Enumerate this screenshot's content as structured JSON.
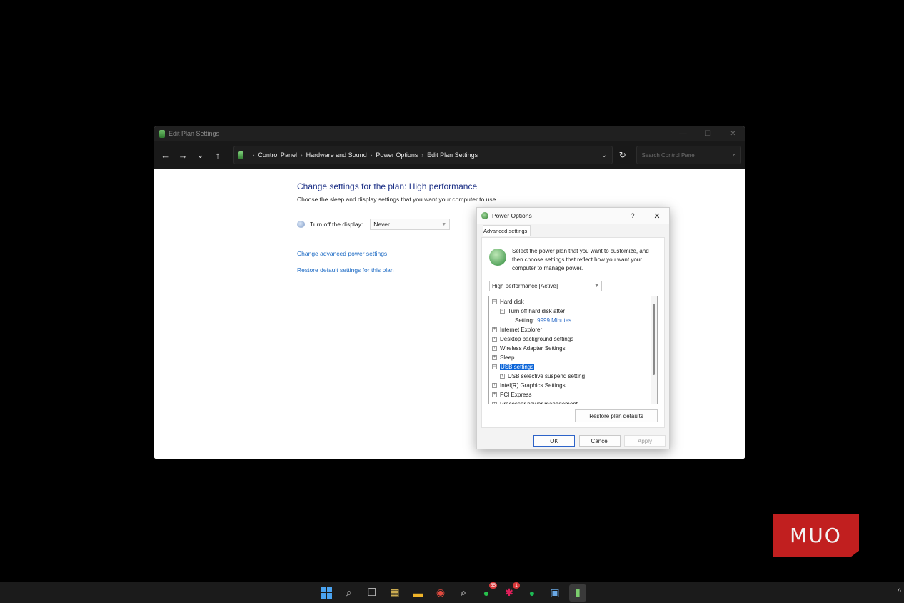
{
  "window": {
    "title": "Edit Plan Settings",
    "controls": {
      "minimize": "—",
      "maximize": "☐",
      "close": "✕"
    }
  },
  "nav": {
    "back": "←",
    "forward": "→",
    "recent": "⌄",
    "up": "↑",
    "breadcrumbs": [
      "Control Panel",
      "Hardware and Sound",
      "Power Options",
      "Edit Plan Settings"
    ],
    "separator": "›",
    "dropdown": "⌄",
    "refresh": "↻",
    "search_placeholder": "Search Control Panel",
    "search_icon": "⌕"
  },
  "main": {
    "heading": "Change settings for the plan: High performance",
    "subheading": "Choose the sleep and display settings that you want your computer to use.",
    "display_label": "Turn off the display:",
    "display_value": "Never",
    "link_advanced": "Change advanced power settings",
    "link_restore": "Restore default settings for this plan"
  },
  "dialog": {
    "title": "Power Options",
    "help": "?",
    "close": "✕",
    "tab": "Advanced settings",
    "intro": "Select the power plan that you want to customize, and then choose settings that reflect how you want your computer to manage power.",
    "plan_value": "High performance [Active]",
    "tree": [
      {
        "label": "Hard disk",
        "expander": "⊟",
        "level": 0
      },
      {
        "label": "Turn off hard disk after",
        "expander": "⊟",
        "level": 1
      },
      {
        "label": "Setting:",
        "value": "9999 Minutes",
        "level": 2
      },
      {
        "label": "Internet Explorer",
        "expander": "⊞",
        "level": 0
      },
      {
        "label": "Desktop background settings",
        "expander": "⊞",
        "level": 0
      },
      {
        "label": "Wireless Adapter Settings",
        "expander": "⊞",
        "level": 0
      },
      {
        "label": "Sleep",
        "expander": "⊞",
        "level": 0
      },
      {
        "label": "USB settings",
        "expander": "⊟",
        "level": 0,
        "selected": true
      },
      {
        "label": "USB selective suspend setting",
        "expander": "⊞",
        "level": 1
      },
      {
        "label": "Intel(R) Graphics Settings",
        "expander": "⊞",
        "level": 0
      },
      {
        "label": "PCI Express",
        "expander": "⊞",
        "level": 0
      },
      {
        "label": "Processor power management",
        "expander": "⊞",
        "level": 0
      }
    ],
    "restore_button": "Restore plan defaults",
    "ok": "OK",
    "cancel": "Cancel",
    "apply": "Apply"
  },
  "watermark": {
    "text": "MUO"
  },
  "taskbar": {
    "items": [
      {
        "name": "start-icon"
      },
      {
        "name": "search-icon"
      },
      {
        "name": "task-view-icon"
      },
      {
        "name": "store-icon"
      },
      {
        "name": "file-explorer-icon"
      },
      {
        "name": "chrome-icon"
      },
      {
        "name": "magnifier-icon"
      },
      {
        "name": "whatsapp-icon",
        "badge": "55"
      },
      {
        "name": "slack-icon",
        "badge": "1"
      },
      {
        "name": "spotify-icon"
      },
      {
        "name": "remote-desktop-icon"
      },
      {
        "name": "power-options-icon",
        "active": true
      }
    ],
    "tray_chevron": "^"
  },
  "colors": {
    "link": "#1c6ac4",
    "heading": "#1e3287",
    "selection": "#0a64d8",
    "brand_red": "#c11f1f"
  }
}
